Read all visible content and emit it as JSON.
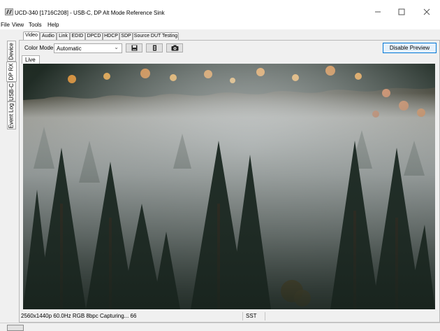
{
  "window": {
    "title": "UCD-340 [1716C208] - USB-C, DP Alt Mode Reference Sink",
    "controls": [
      "minimize",
      "maximize",
      "close"
    ]
  },
  "menu": [
    "File",
    "View",
    "Tools",
    "Help"
  ],
  "side_tabs": [
    {
      "label": "Device",
      "active": false
    },
    {
      "label": "DP RX",
      "active": true
    },
    {
      "label": "USB-C",
      "active": false
    },
    {
      "label": "Event Log",
      "active": false
    }
  ],
  "top_tabs": [
    {
      "label": "Video",
      "active": true
    },
    {
      "label": "Audio",
      "active": false
    },
    {
      "label": "Link",
      "active": false
    },
    {
      "label": "EDID",
      "active": false
    },
    {
      "label": "DPCD",
      "active": false
    },
    {
      "label": "HDCP",
      "active": false
    },
    {
      "label": "SDP",
      "active": false
    },
    {
      "label": "Source DUT Testing",
      "active": false
    }
  ],
  "toolbar": {
    "color_mode_label": "Color Mode",
    "color_mode_value": "Automatic",
    "icons": [
      "save-icon",
      "frame-icon",
      "camera-icon"
    ],
    "disable_preview_label": "Disable Preview"
  },
  "preview": {
    "tab_label": "Live",
    "image": "misty forest with pine trees"
  },
  "status": {
    "info": "2560x1440p 60.0Hz RGB 8bpc Capturing... 66",
    "mode": "SST"
  },
  "colors": {
    "accent": "#0078d7",
    "button_bg": "#e5f1fb",
    "panel_bg": "#f0f0f0"
  }
}
